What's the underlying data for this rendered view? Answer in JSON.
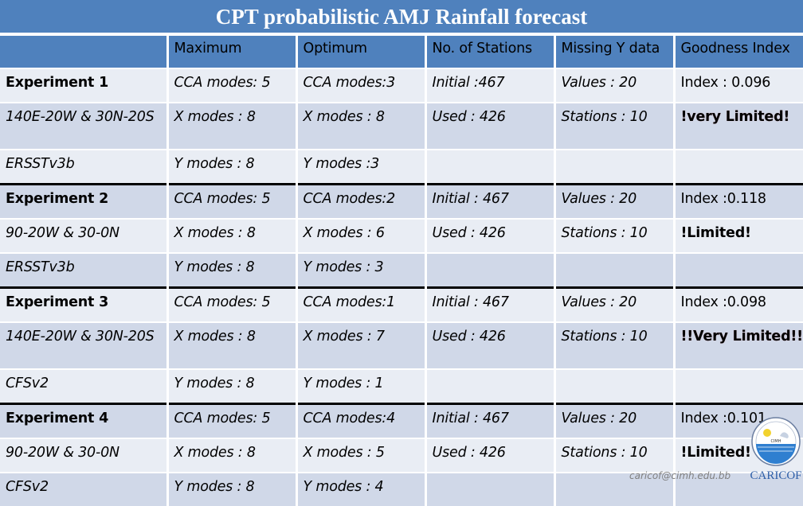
{
  "title": "CPT probabilistic AMJ Rainfall forecast",
  "columns": [
    "",
    "Maximum",
    "Optimum",
    "No. of Stations",
    "Missing Y data",
    "Goodness Index"
  ],
  "experiments": [
    {
      "rows": [
        [
          "Experiment 1",
          "CCA modes: 5",
          "CCA modes:3",
          "Initial :467",
          "Values : 20",
          "Index : 0.096"
        ],
        [
          "140E-20W & 30N-20S",
          "X modes : 8",
          "X modes : 8",
          "Used : 426",
          "Stations : 10",
          "!very Limited!"
        ],
        [
          "ERSSTv3b",
          "Y modes : 8",
          "Y modes :3",
          "",
          "",
          ""
        ]
      ]
    },
    {
      "rows": [
        [
          "Experiment 2",
          "CCA modes: 5",
          "CCA modes:2",
          "Initial : 467",
          "Values : 20",
          "Index :0.118"
        ],
        [
          "90-20W & 30-0N",
          "X modes : 8",
          "X modes : 6",
          "Used : 426",
          "Stations : 10",
          "!Limited!"
        ],
        [
          "ERSSTv3b",
          "Y modes : 8",
          "Y modes : 3",
          "",
          "",
          ""
        ]
      ]
    },
    {
      "rows": [
        [
          "Experiment 3",
          "CCA modes: 5",
          "CCA modes:1",
          "Initial : 467",
          "Values : 20",
          "Index :0.098"
        ],
        [
          "140E-20W & 30N-20S",
          "X modes : 8",
          "X modes : 7",
          "Used : 426",
          "Stations : 10",
          "!!Very Limited!!"
        ],
        [
          "CFSv2",
          "Y modes : 8",
          "Y modes : 1",
          "",
          "",
          ""
        ]
      ]
    },
    {
      "rows": [
        [
          "Experiment 4",
          "CCA modes: 5",
          "CCA modes:4",
          "Initial : 467",
          "Values : 20",
          "Index :0.101"
        ],
        [
          "90-20W & 30-0N",
          "X modes : 8",
          "X modes : 5",
          "Used : 426",
          "Stations : 10",
          "!Limited!"
        ],
        [
          "CFSv2",
          "Y modes : 8",
          "Y modes : 4",
          "",
          "",
          ""
        ]
      ]
    }
  ],
  "footer": {
    "email": "caricof@cimh.edu.bb",
    "logo_name": "CARICOF",
    "logo_badge_text": "CIMH"
  },
  "colors": {
    "header_blue": "#4f81bd",
    "row_light": "#e9edf4",
    "row_dark": "#d0d8e8",
    "warning_red": "#e3141d"
  }
}
